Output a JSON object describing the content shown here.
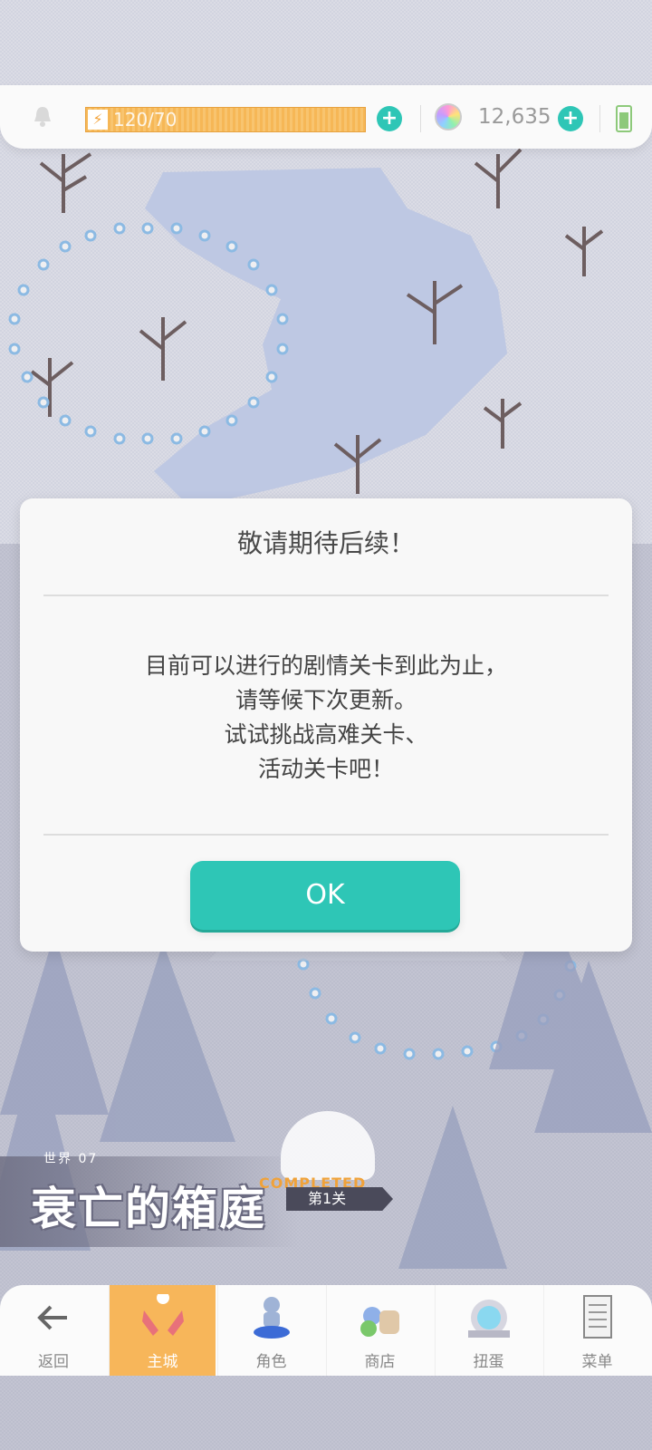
{
  "status_bar": {
    "stamina": "120/70",
    "gems": "12,635"
  },
  "world": {
    "label": "世界 07",
    "title": "衰亡的箱庭",
    "completed": "COMPLETED",
    "stage": "第1关"
  },
  "dialog": {
    "title": "敬请期待后续！",
    "lines": [
      "目前可以进行的剧情关卡到此为止，",
      "请等候下次更新。",
      "试试挑战高难关卡、",
      "活动关卡吧！"
    ],
    "ok": "OK"
  },
  "nav": {
    "items": [
      {
        "label": "返回",
        "icon": "back-arrow-icon"
      },
      {
        "label": "主城",
        "icon": "castle-icon",
        "active": true
      },
      {
        "label": "角色",
        "icon": "character-icon"
      },
      {
        "label": "商店",
        "icon": "shop-icon"
      },
      {
        "label": "扭蛋",
        "icon": "gacha-icon"
      },
      {
        "label": "菜单",
        "icon": "menu-icon"
      }
    ]
  },
  "colors": {
    "accent": "#2ec6b6",
    "stamina": "#f6b756",
    "active_nav": "#f7b65a"
  }
}
